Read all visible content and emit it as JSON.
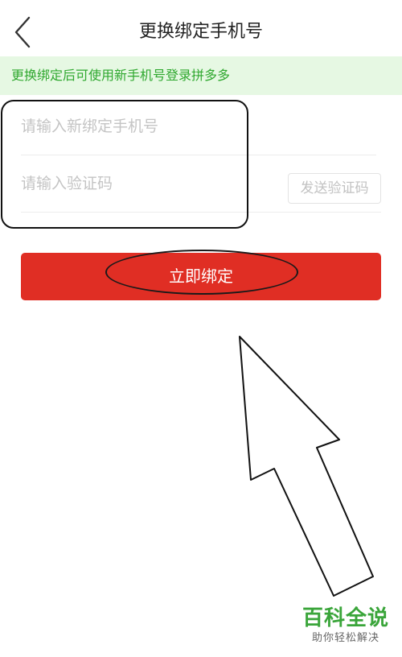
{
  "header": {
    "title": "更换绑定手机号",
    "back_icon": "chevron-left-icon"
  },
  "notice": {
    "text": "更换绑定后可使用新手机号登录拼多多",
    "bg_color": "#e6f8e3",
    "text_color": "#2fa82f"
  },
  "form": {
    "phone_placeholder": "请输入新绑定手机号",
    "phone_value": "",
    "code_placeholder": "请输入验证码",
    "code_value": "",
    "send_code_label": "发送验证码"
  },
  "bind_button": {
    "label": "立即绑定",
    "color": "#e02e24"
  },
  "watermark": {
    "title": "百科全说",
    "subtitle": "助你轻松解决"
  }
}
